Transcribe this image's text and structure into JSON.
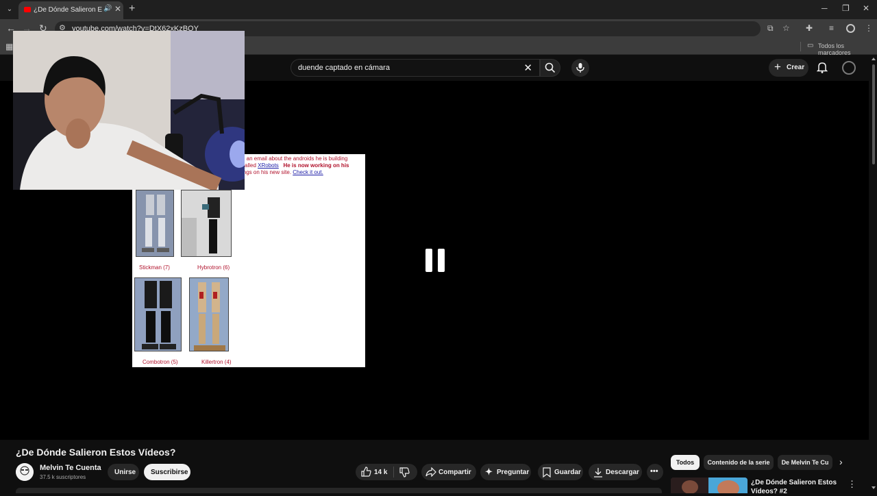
{
  "browser": {
    "tab_title": "¿De Dónde Salieron Estos V",
    "url": "youtube.com/watch?v=DtX62xKzBQY",
    "bookmarks_label": "Todos los marcadores"
  },
  "youtube": {
    "search_query": "duende captado en cámara",
    "create_label": "Crear"
  },
  "video_frame": {
    "page_line1": "e an email about the androids he is building",
    "page_line2_a": "called ",
    "page_line2_link": "XRobots",
    "page_line2_b": "He is now working on his",
    "page_line3_a": "ings on his new site. ",
    "page_line3_link": "Check it out.",
    "robots": [
      {
        "label": "Stickman (7)"
      },
      {
        "label": "Hybrotron (6)"
      },
      {
        "label": "Combotron (5)"
      },
      {
        "label": "Killertron (4)"
      }
    ]
  },
  "video": {
    "title": "¿De Dónde Salieron Estos Vídeos?",
    "channel_name": "Melvin Te Cuenta",
    "subscribers": "37.5 k suscriptores",
    "join_label": "Unirse",
    "subscribe_label": "Suscribirse",
    "likes": "14 k",
    "share_label": "Compartir",
    "ask_label": "Preguntar",
    "save_label": "Guardar",
    "download_label": "Descargar"
  },
  "recommendations": {
    "chips": [
      "Todos",
      "Contenido de la serie",
      "De Melvin Te Cu"
    ],
    "first_title": "¿De Dónde Salieron Estos Vídeos? #2"
  },
  "colors": {
    "background": "#0f0f0f",
    "accent": "#ff0000",
    "page_link": "#1a1aa6",
    "page_text": "#b0102a"
  }
}
